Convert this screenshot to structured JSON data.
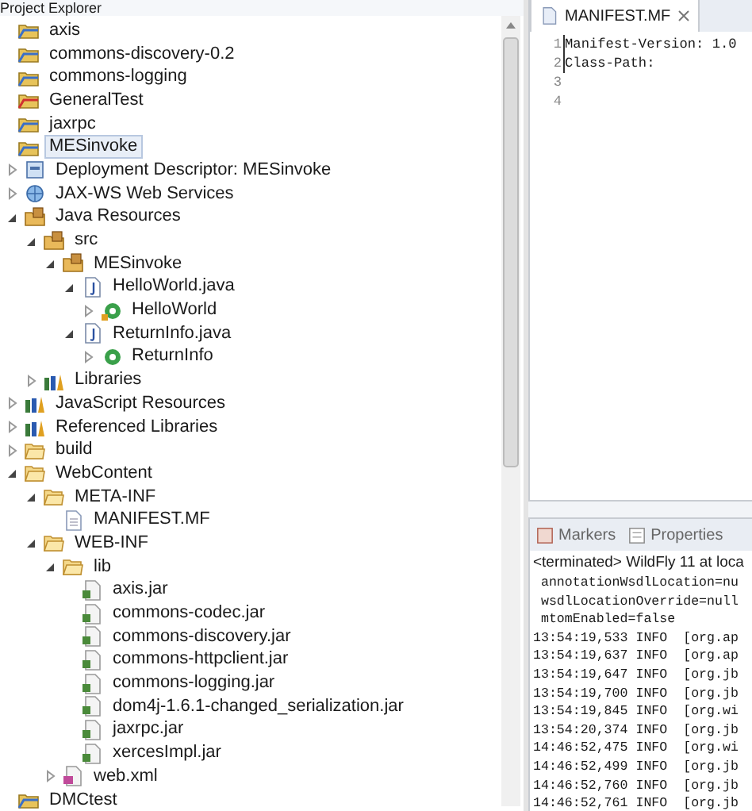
{
  "explorer": {
    "title": "Project Explorer",
    "items": [
      {
        "label": "axis",
        "kind": "project",
        "selected": false
      },
      {
        "label": "commons-discovery-0.2",
        "kind": "project",
        "selected": false
      },
      {
        "label": "commons-logging",
        "kind": "project",
        "selected": false
      },
      {
        "label": "GeneralTest",
        "kind": "project-error",
        "selected": false
      },
      {
        "label": "jaxrpc",
        "kind": "project",
        "selected": false
      },
      {
        "label": "MESinvoke",
        "kind": "project",
        "selected": true,
        "children": [
          {
            "label": "Deployment Descriptor: MESinvoke",
            "kind": "descriptor",
            "expanded": false,
            "selected": false
          },
          {
            "label": "JAX-WS Web Services",
            "kind": "webservice",
            "expanded": false,
            "selected": false
          },
          {
            "label": "Java Resources",
            "kind": "javares",
            "expanded": true,
            "selected": false,
            "children": [
              {
                "label": "src",
                "kind": "source-folder",
                "expanded": true,
                "selected": false,
                "children": [
                  {
                    "label": "MESinvoke",
                    "kind": "package",
                    "expanded": true,
                    "selected": false,
                    "children": [
                      {
                        "label": "HelloWorld.java",
                        "kind": "java-file",
                        "expanded": true,
                        "selected": false,
                        "children": [
                          {
                            "label": "HelloWorld",
                            "kind": "class-marked",
                            "expanded": false,
                            "selected": false
                          }
                        ]
                      },
                      {
                        "label": "ReturnInfo.java",
                        "kind": "java-file",
                        "expanded": true,
                        "selected": false,
                        "children": [
                          {
                            "label": "ReturnInfo",
                            "kind": "class",
                            "expanded": false,
                            "selected": false
                          }
                        ]
                      }
                    ]
                  }
                ]
              },
              {
                "label": "Libraries",
                "kind": "library",
                "expanded": false,
                "selected": false
              }
            ]
          },
          {
            "label": "JavaScript Resources",
            "kind": "library",
            "expanded": false,
            "selected": false
          },
          {
            "label": "Referenced Libraries",
            "kind": "library",
            "expanded": false,
            "selected": false
          },
          {
            "label": "build",
            "kind": "folder",
            "expanded": false,
            "selected": false
          },
          {
            "label": "WebContent",
            "kind": "folder",
            "expanded": true,
            "selected": false,
            "children": [
              {
                "label": "META-INF",
                "kind": "folder",
                "expanded": true,
                "selected": false,
                "children": [
                  {
                    "label": "MANIFEST.MF",
                    "kind": "file",
                    "selected": false
                  }
                ]
              },
              {
                "label": "WEB-INF",
                "kind": "folder",
                "expanded": true,
                "selected": false,
                "children": [
                  {
                    "label": "lib",
                    "kind": "folder",
                    "expanded": true,
                    "selected": false,
                    "children": [
                      {
                        "label": "axis.jar",
                        "kind": "jar",
                        "selected": false
                      },
                      {
                        "label": "commons-codec.jar",
                        "kind": "jar",
                        "selected": false
                      },
                      {
                        "label": "commons-discovery.jar",
                        "kind": "jar",
                        "selected": false
                      },
                      {
                        "label": "commons-httpclient.jar",
                        "kind": "jar",
                        "selected": false
                      },
                      {
                        "label": "commons-logging.jar",
                        "kind": "jar",
                        "selected": false
                      },
                      {
                        "label": "dom4j-1.6.1-changed_serialization.jar",
                        "kind": "jar",
                        "selected": false
                      },
                      {
                        "label": "jaxrpc.jar",
                        "kind": "jar",
                        "selected": false
                      },
                      {
                        "label": "xercesImpl.jar",
                        "kind": "jar",
                        "selected": false
                      }
                    ]
                  },
                  {
                    "label": "web.xml",
                    "kind": "xml",
                    "expanded": false,
                    "selected": false
                  }
                ]
              }
            ]
          }
        ]
      },
      {
        "label": "DMCtest",
        "kind": "project",
        "selected": false
      }
    ]
  },
  "editor": {
    "tab": "MANIFEST.MF",
    "lines": [
      {
        "number": "1",
        "text": "Manifest-Version: 1.0"
      },
      {
        "number": "2",
        "text": "Class-Path:"
      },
      {
        "number": "3"
      },
      {
        "number": "4"
      }
    ]
  },
  "console": {
    "tabs": [
      {
        "label": "Markers",
        "kind": "markers",
        "selected": false
      },
      {
        "label": "Properties",
        "kind": "properties",
        "selected": false
      }
    ],
    "status": "<terminated> WildFly 11 at loca",
    "lines": [
      " annotationWsdlLocation=nu",
      " wsdlLocationOverride=null",
      " mtomEnabled=false",
      "13:54:19,533 INFO  [org.ap",
      "13:54:19,637 INFO  [org.ap",
      "13:54:19,647 INFO  [org.jb",
      "13:54:19,700 INFO  [org.jb",
      "13:54:19,845 INFO  [org.wi",
      "13:54:20,374 INFO  [org.jb",
      "14:46:52,475 INFO  [org.wi",
      "14:46:52,499 INFO  [org.jb",
      "14:46:52,760 INFO  [org.jb",
      "14:46:52,761 INFO  [org.jb"
    ]
  }
}
